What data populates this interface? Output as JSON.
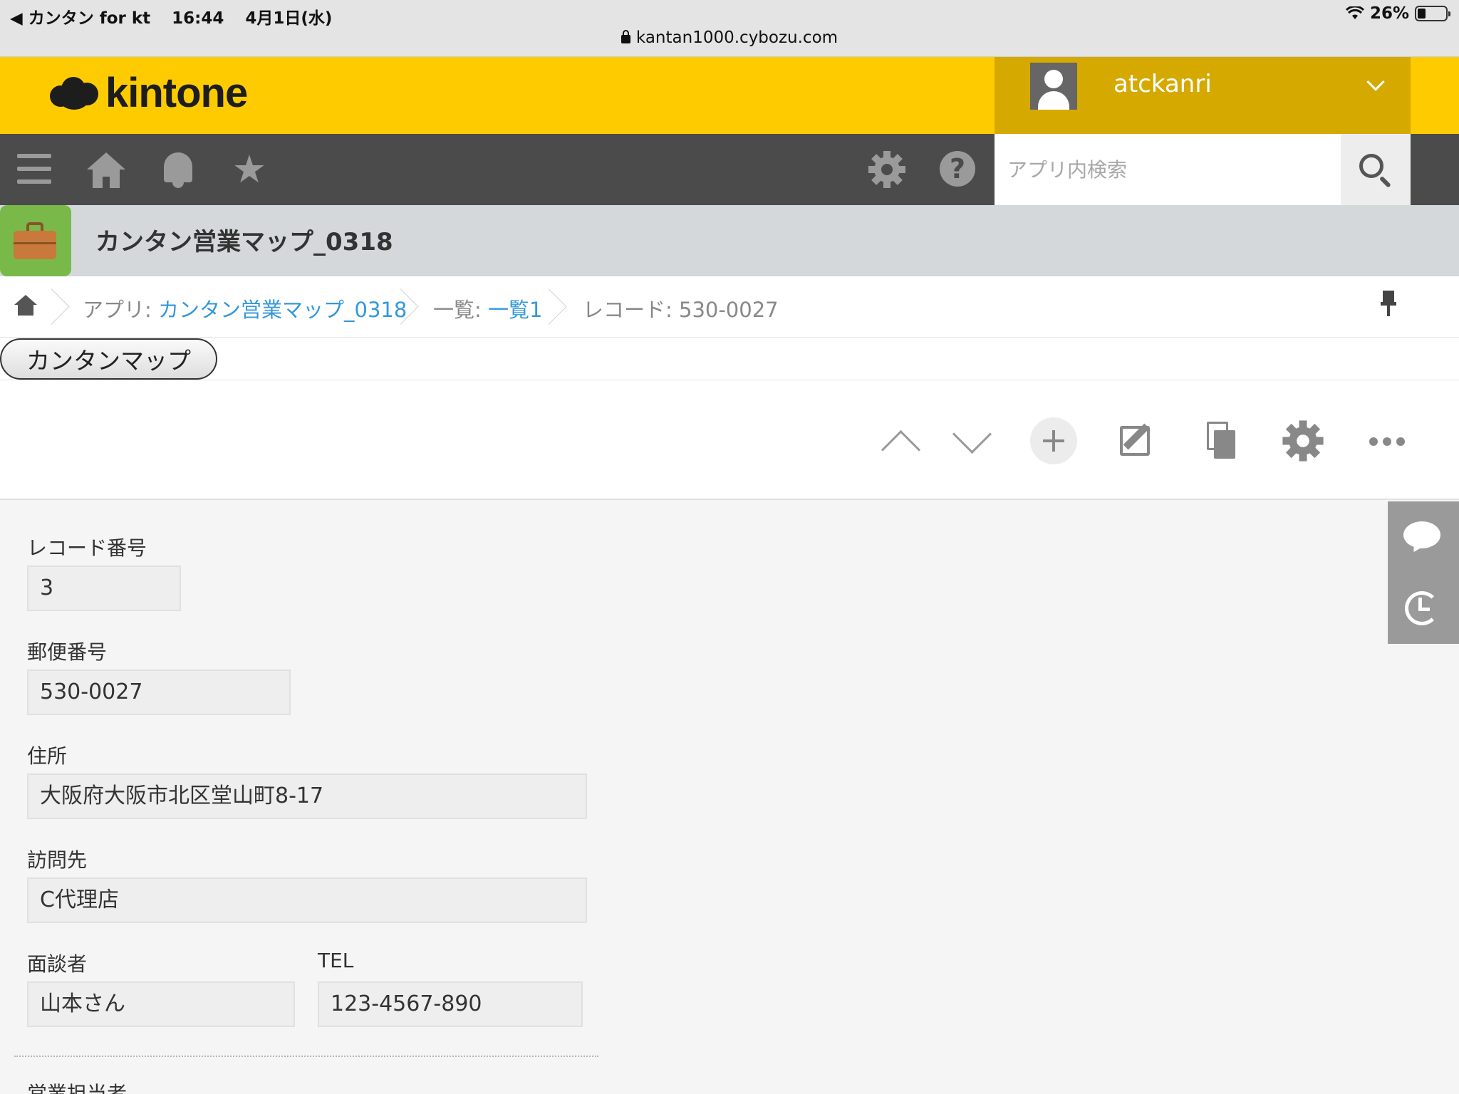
{
  "status_bar": {
    "back_app": "◀ カンタン for kt",
    "time": "16:44",
    "date": "4月1日(水)",
    "battery": "26%",
    "url": "kantan1000.cybozu.com"
  },
  "header": {
    "logo_text": "kintone",
    "username": "atckanri"
  },
  "toolbar": {
    "search_placeholder": "アプリ内検索"
  },
  "app": {
    "title": "カンタン営業マップ_0318"
  },
  "breadcrumb": {
    "app_prefix": "アプリ: ",
    "app_link": "カンタン営業マップ_0318",
    "list_prefix": "一覧: ",
    "list_link": "一覧1",
    "record": "レコード: 530-0027"
  },
  "custom": {
    "map_button": "カンタンマップ"
  },
  "record": {
    "fields": [
      {
        "label": "レコード番号",
        "value": "3"
      },
      {
        "label": "郵便番号",
        "value": "530-0027"
      },
      {
        "label": "住所",
        "value": "大阪府大阪市北区堂山町8-17"
      },
      {
        "label": "訪問先",
        "value": "C代理店"
      },
      {
        "label": "面談者",
        "value": "山本さん"
      },
      {
        "label": "TEL",
        "value": "123-4567-890"
      },
      {
        "label": "営業担当者",
        "value": ""
      }
    ]
  },
  "colors": {
    "header_bg": "#fecb00",
    "user_bg": "#d5a900",
    "toolbar_bg": "#4b4b4b",
    "link": "#3498db"
  }
}
